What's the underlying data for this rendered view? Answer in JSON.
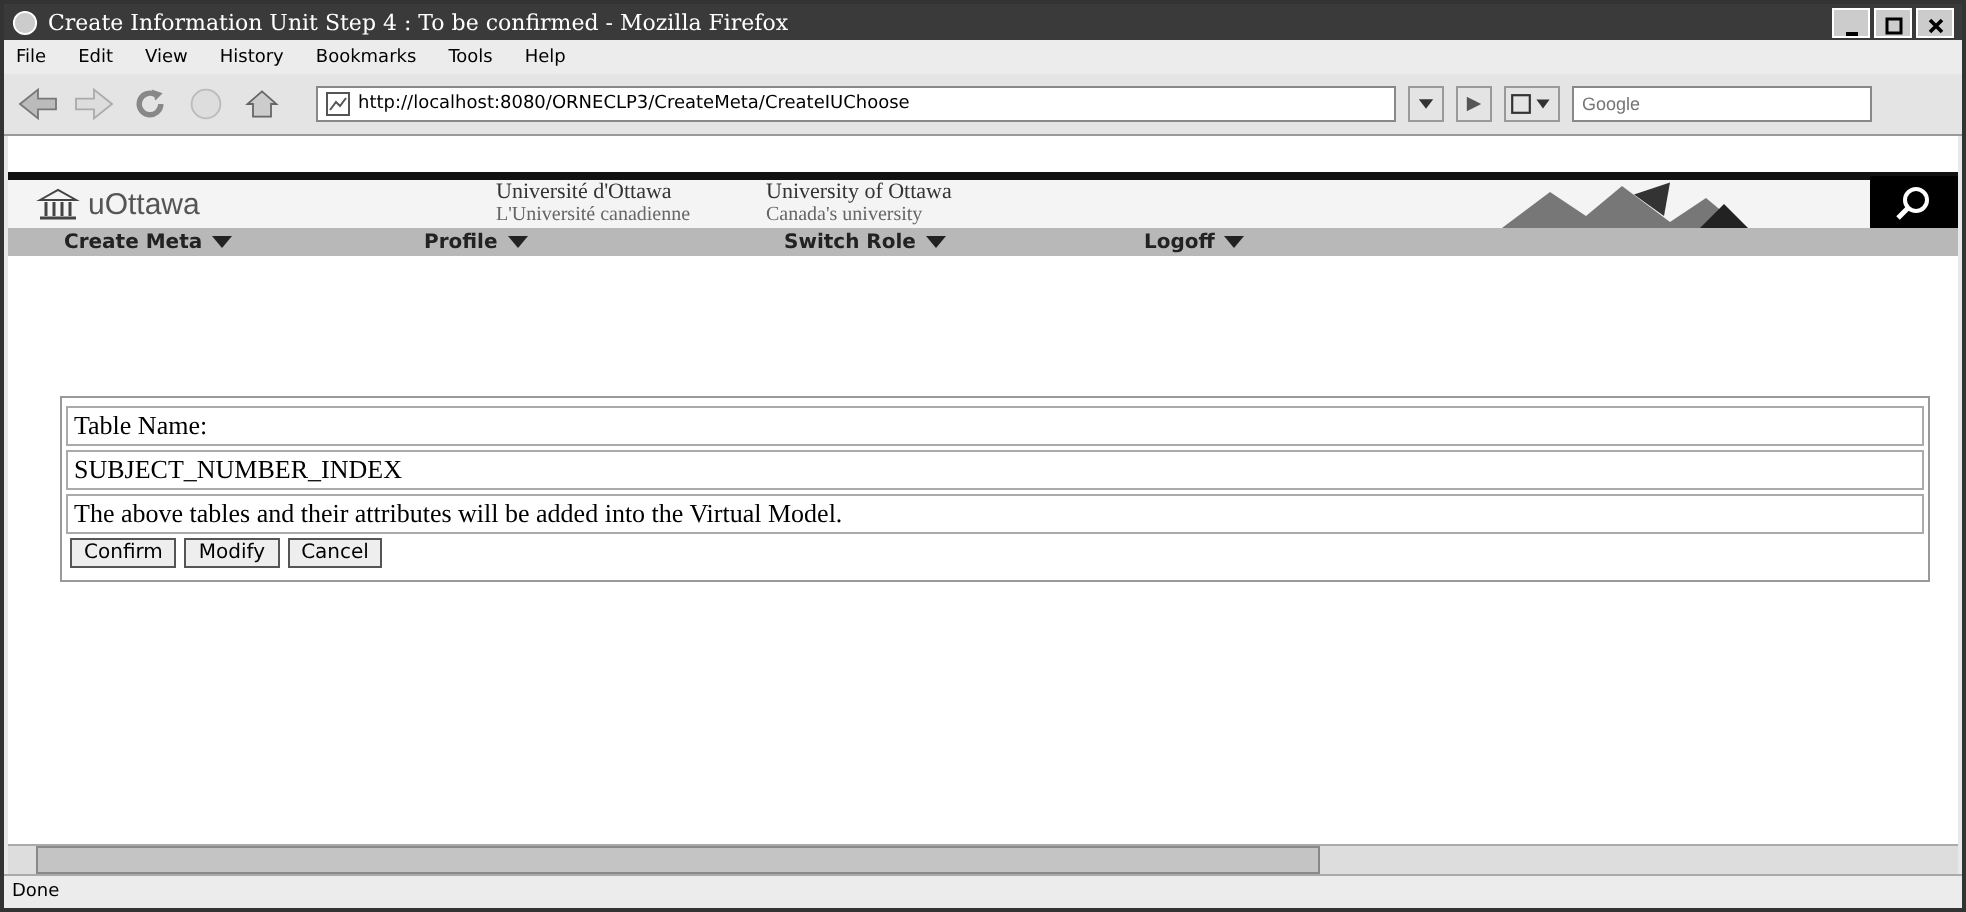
{
  "window": {
    "title": "Create Information Unit Step 4 : To be confirmed - Mozilla Firefox"
  },
  "menu": [
    "File",
    "Edit",
    "View",
    "History",
    "Bookmarks",
    "Tools",
    "Help"
  ],
  "toolbar": {
    "url": "http://localhost:8080/ORNECLP3/CreateMeta/CreateIUChoose",
    "search": {
      "placeholder": "Google"
    }
  },
  "banner": {
    "logo": "uOttawa",
    "fr_name": "Université d'Ottawa",
    "fr_tagline": "L'Université canadienne",
    "en_name": "University of Ottawa",
    "en_tagline": "Canada's university"
  },
  "nav": [
    "Create Meta",
    "Profile",
    "Switch Role",
    "Logoff"
  ],
  "form": {
    "rows": [
      "Table Name:",
      "SUBJECT_NUMBER_INDEX",
      "The above tables and their attributes will be added into the Virtual Model."
    ],
    "buttons": [
      "Confirm",
      "Modify",
      "Cancel"
    ]
  },
  "status_bar": "Done"
}
